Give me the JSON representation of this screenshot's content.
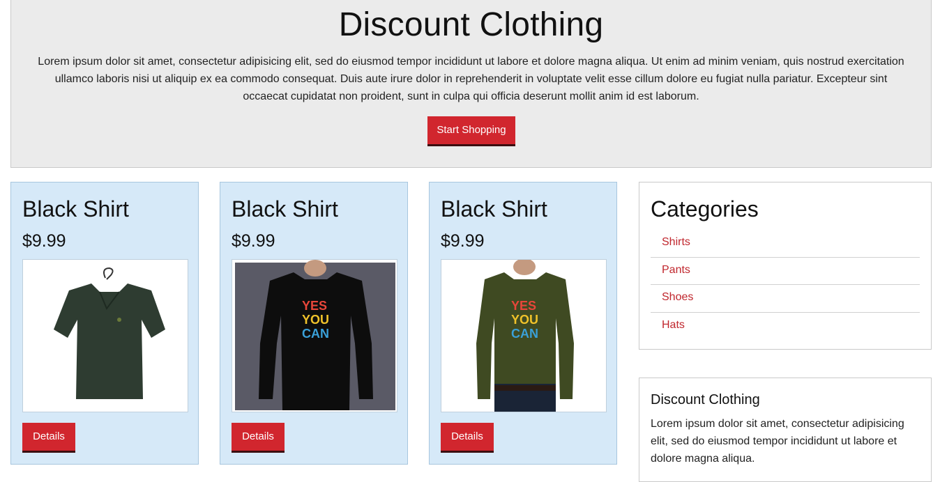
{
  "hero": {
    "title": "Discount Clothing",
    "text": "Lorem ipsum dolor sit amet, consectetur adipisicing elit, sed do eiusmod tempor incididunt ut labore et dolore magna aliqua. Ut enim ad minim veniam, quis nostrud exercitation ullamco laboris nisi ut aliquip ex ea commodo consequat. Duis aute irure dolor in reprehenderit in voluptate velit esse cillum dolore eu fugiat nulla pariatur. Excepteur sint occaecat cupidatat non proident, sunt in culpa qui officia deserunt mollit anim id est laborum.",
    "button_label": "Start Shopping"
  },
  "products": [
    {
      "name": "Black Shirt",
      "price": "$9.99",
      "button_label": "Details",
      "image": "green-polo-shirt-on-hanger"
    },
    {
      "name": "Black Shirt",
      "price": "$9.99",
      "button_label": "Details",
      "image": "black-long-sleeve-yes-you-can-tshirt"
    },
    {
      "name": "Black Shirt",
      "price": "$9.99",
      "button_label": "Details",
      "image": "olive-long-sleeve-yes-you-can-tshirt"
    }
  ],
  "categories": {
    "title": "Categories",
    "items": [
      "Shirts",
      "Pants",
      "Shoes",
      "Hats"
    ]
  },
  "about": {
    "title": "Discount Clothing",
    "text": "Lorem ipsum dolor sit amet, consectetur adipisicing elit, sed do eiusmod tempor incididunt ut labore et dolore magna aliqua."
  },
  "colors": {
    "accent": "#d1262e",
    "card_bg": "#d6e9f8",
    "hero_bg": "#ebebeb"
  }
}
